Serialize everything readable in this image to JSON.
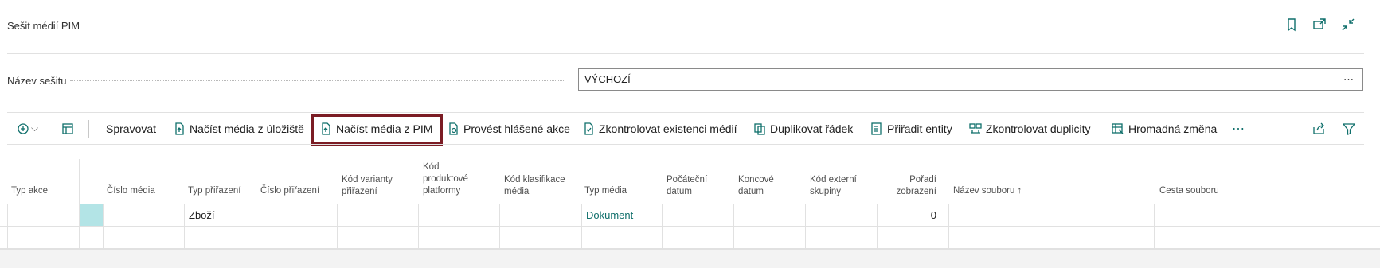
{
  "header": {
    "title": "Sešit médií PIM",
    "icons": [
      "bookmark-icon",
      "open-new-window-icon",
      "collapse-icon"
    ]
  },
  "batch": {
    "label": "Název sešitu",
    "value": "VÝCHOZÍ",
    "ellipsis": "⋯"
  },
  "toolbar": {
    "manage": "Spravovat",
    "load_storage": "Načíst média z úložiště",
    "load_pim": "Načíst média z PIM",
    "process": "Provést hlášené akce",
    "check_existence": "Zkontrolovat existenci médií",
    "duplicate_line": "Duplikovat řádek",
    "assign_entities": "Přiřadit entity",
    "check_duplicates": "Zkontrolovat duplicity",
    "bulk_change": "Hromadná změna",
    "more": "⋯"
  },
  "columns": {
    "action_type": "Typ akce",
    "media_no": "Číslo média",
    "assign_type": "Typ přiřazení",
    "assign_no": "Číslo přiřazení",
    "variant_code": "Kód varianty přiřazení",
    "platform_code": "Kód produktové platformy",
    "class_code": "Kód klasifikace média",
    "media_type": "Typ média",
    "start_date": "Počáteční datum",
    "end_date": "Koncové datum",
    "ext_group": "Kód externí skupiny",
    "order": "Pořadí zobrazení",
    "filename": "Název souboru ↑",
    "filepath": "Cesta souboru"
  },
  "rows": [
    {
      "assign_type": "Zboží",
      "media_type": "Dokument",
      "order": "0"
    }
  ]
}
